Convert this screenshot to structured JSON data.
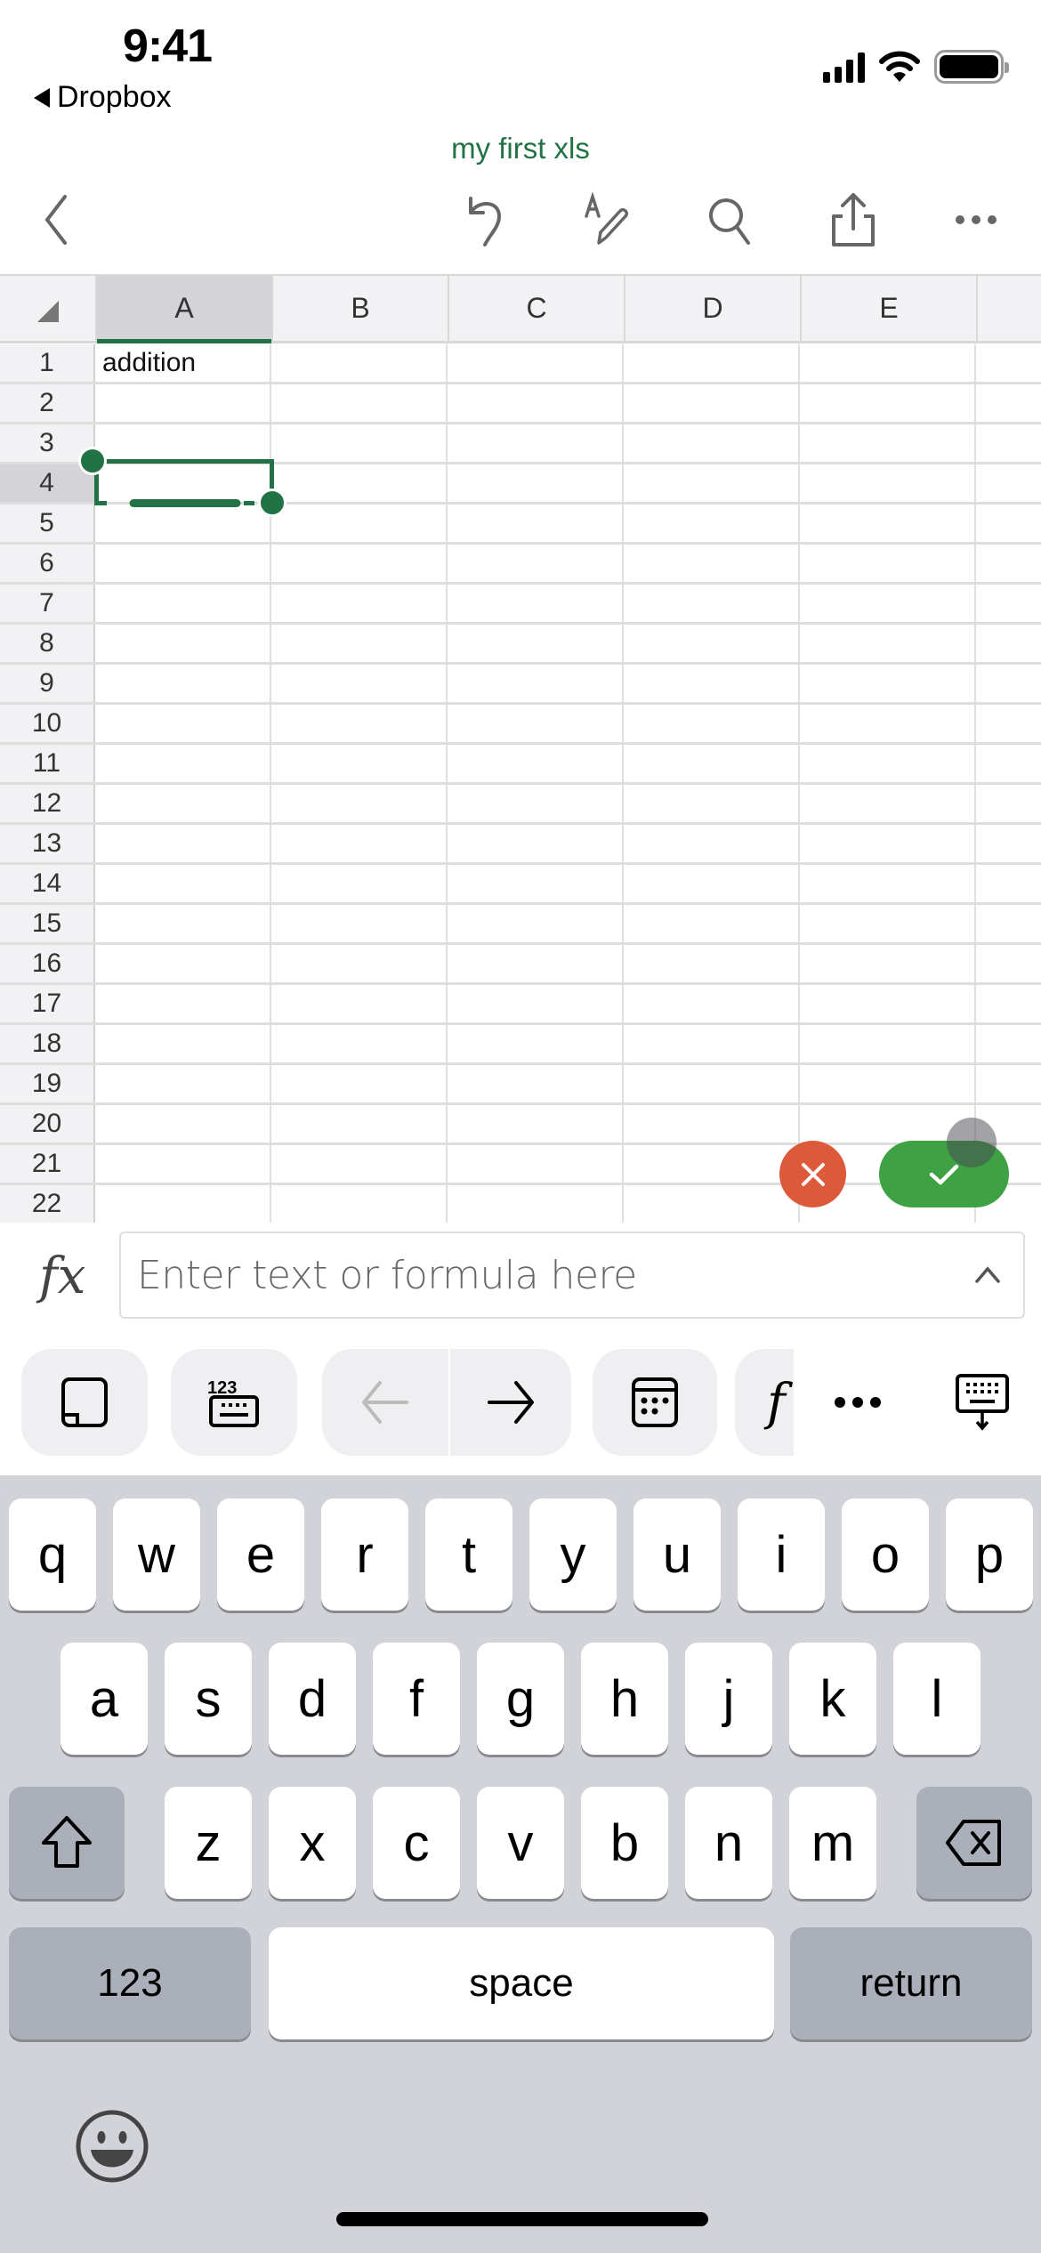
{
  "status_bar": {
    "time": "9:41",
    "back_app_label": "Dropbox",
    "icons": [
      "cellular-signal-icon",
      "wifi-icon",
      "battery-icon"
    ]
  },
  "document": {
    "title": "my first xls"
  },
  "toolbar": {
    "icons": [
      "back-chevron-icon",
      "undo-icon",
      "draw-pen-icon",
      "search-icon",
      "share-icon",
      "more-icon"
    ]
  },
  "sheet": {
    "columns": [
      "A",
      "B",
      "C",
      "D",
      "E"
    ],
    "selected_column": "A",
    "rows": [
      "1",
      "2",
      "3",
      "4",
      "5",
      "6",
      "7",
      "8",
      "9",
      "10",
      "11",
      "12",
      "13",
      "14",
      "15",
      "16",
      "17",
      "18",
      "19",
      "20",
      "21",
      "22"
    ],
    "selected_row": "4",
    "cells": {
      "A1": "addition"
    },
    "active_cell": "A4"
  },
  "edit_actions": {
    "cancel_icon": "close-icon",
    "confirm_icon": "checkmark-icon"
  },
  "formula_bar": {
    "fx_label": "fx",
    "value": "",
    "placeholder": "Enter text or formula here"
  },
  "accessory_bar": {
    "items": [
      "sheet-view-icon",
      "numeric-keyboard-icon",
      "arrow-left-icon",
      "arrow-right-icon",
      "calendar-icon",
      "function-icon",
      "more-icon",
      "dismiss-keyboard-icon"
    ]
  },
  "keyboard": {
    "row1": [
      "q",
      "w",
      "e",
      "r",
      "t",
      "y",
      "u",
      "i",
      "o",
      "p"
    ],
    "row2": [
      "a",
      "s",
      "d",
      "f",
      "g",
      "h",
      "j",
      "k",
      "l"
    ],
    "row3": [
      "z",
      "x",
      "c",
      "v",
      "b",
      "n",
      "m"
    ],
    "numbers_label": "123",
    "space_label": "space",
    "return_label": "return"
  },
  "colors": {
    "accent": "#217346",
    "cancel": "#dc5a3a",
    "confirm": "#3ea144"
  }
}
